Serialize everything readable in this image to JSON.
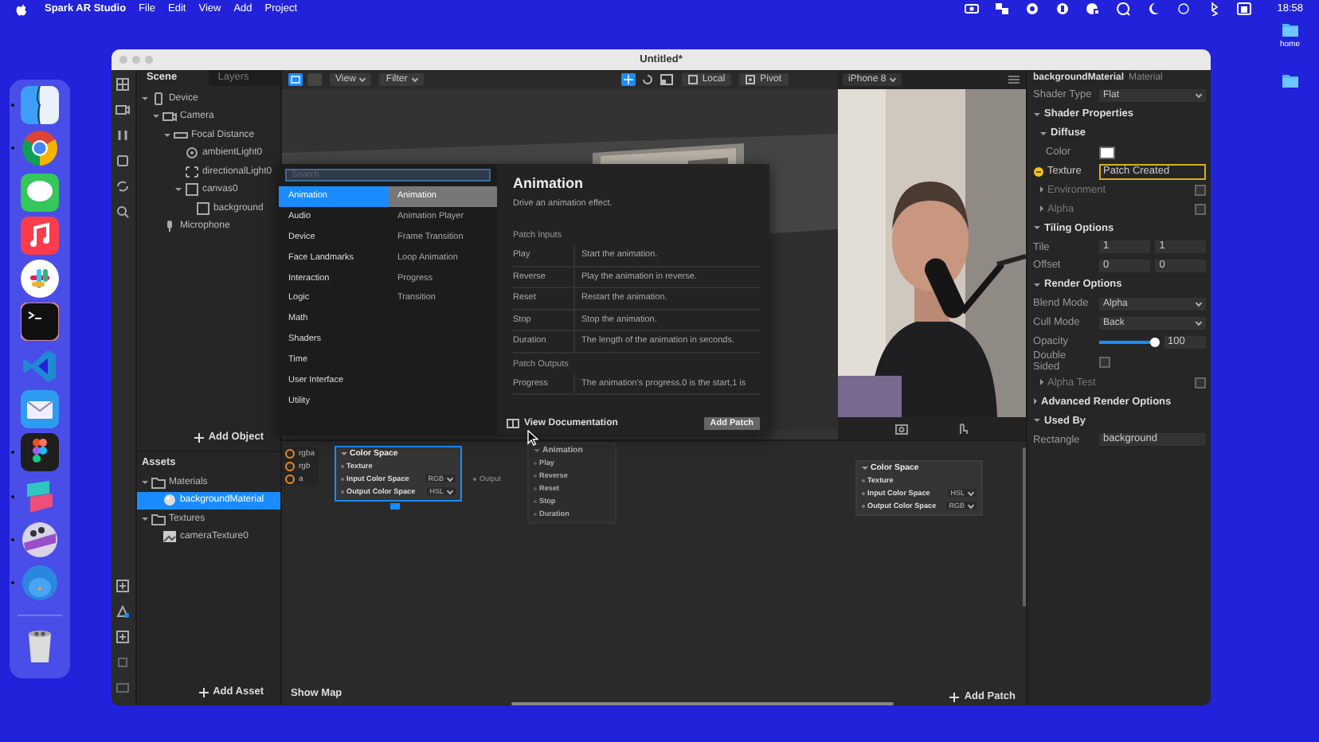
{
  "menubar": {
    "app": "Spark AR Studio",
    "menus": [
      "File",
      "Edit",
      "View",
      "Add",
      "Project"
    ],
    "clock": "18:58"
  },
  "desktop": {
    "folders": [
      {
        "label": "home"
      }
    ]
  },
  "dock": {
    "apps": [
      {
        "running": true
      },
      {
        "running": true
      },
      {
        "running": false
      },
      {
        "running": false
      },
      {
        "running": false
      },
      {
        "running": false
      },
      {
        "running": false
      },
      {
        "running": false
      },
      {
        "running": true
      },
      {
        "running": true
      },
      {
        "running": true
      },
      {
        "running": true
      },
      {
        "running": false
      }
    ]
  },
  "window": {
    "title": "Untitled*"
  },
  "scene": {
    "tabs": [
      {
        "label": "Scene",
        "selected": true
      },
      {
        "label": "Layers",
        "selected": false
      }
    ],
    "tree": [
      {
        "label": "Device",
        "kind": "device",
        "expanded": true,
        "children": [
          {
            "label": "Camera",
            "kind": "camera",
            "expanded": true,
            "children": [
              {
                "label": "Focal Distance",
                "kind": "focal",
                "expanded": true,
                "children": [
                  {
                    "label": "ambientLight0",
                    "kind": "light"
                  },
                  {
                    "label": "directionalLight0",
                    "kind": "directional"
                  },
                  {
                    "label": "canvas0",
                    "kind": "canvas",
                    "expanded": true,
                    "children": [
                      {
                        "label": "background",
                        "kind": "rect"
                      }
                    ]
                  }
                ]
              }
            ]
          },
          {
            "label": "Microphone",
            "kind": "mic"
          }
        ]
      }
    ],
    "add_button": "Add Object"
  },
  "assets": {
    "title": "Assets",
    "tree": [
      {
        "label": "Materials",
        "kind": "folder",
        "expanded": true,
        "selected": false,
        "children": [
          {
            "label": "backgroundMaterial",
            "kind": "material",
            "selected": true
          }
        ]
      },
      {
        "label": "Textures",
        "kind": "folder",
        "expanded": true,
        "selected": false,
        "children": [
          {
            "label": "cameraTexture0",
            "kind": "texture",
            "selected": false
          }
        ]
      }
    ],
    "add_button": "Add Asset"
  },
  "viewport": {
    "view": "View",
    "filter": "Filter",
    "local": "Local",
    "pivot": "Pivot"
  },
  "simulator": {
    "device": "iPhone 8"
  },
  "popup": {
    "search_placeholder": "Search",
    "categories": [
      {
        "label": "Animation",
        "selected": true
      },
      {
        "label": "Audio",
        "selected": false
      },
      {
        "label": "Device",
        "selected": false
      },
      {
        "label": "Face Landmarks",
        "selected": false
      },
      {
        "label": "Interaction",
        "selected": false
      },
      {
        "label": "Logic",
        "selected": false
      },
      {
        "label": "Math",
        "selected": false
      },
      {
        "label": "Shaders",
        "selected": false
      },
      {
        "label": "Time",
        "selected": false
      },
      {
        "label": "User Interface",
        "selected": false
      },
      {
        "label": "Utility",
        "selected": false
      }
    ],
    "patches": [
      {
        "label": "Animation",
        "selected": true
      },
      {
        "label": "Animation Player",
        "selected": false
      },
      {
        "label": "Frame Transition",
        "selected": false
      },
      {
        "label": "Loop Animation",
        "selected": false
      },
      {
        "label": "Progress",
        "selected": false
      },
      {
        "label": "Transition",
        "selected": false
      }
    ],
    "detail": {
      "title": "Animation",
      "description": "Drive an animation effect.",
      "inputs_heading": "Patch Inputs",
      "inputs": [
        {
          "name": "Play",
          "text": "Start the animation."
        },
        {
          "name": "Reverse",
          "text": "Play the animation in reverse."
        },
        {
          "name": "Reset",
          "text": "Restart the animation."
        },
        {
          "name": "Stop",
          "text": "Stop the animation."
        },
        {
          "name": "Duration",
          "text": "The length of the animation in seconds."
        }
      ],
      "outputs_heading": "Patch Outputs",
      "outputs": [
        {
          "name": "Progress",
          "text": "The animation's progress.0 is the start,1 is"
        }
      ],
      "doc_link": "View Documentation",
      "add_button": "Add Patch"
    }
  },
  "patch_editor": {
    "inputs": [
      "rgba",
      "rgb",
      "a"
    ],
    "nodes": [
      {
        "title": "Color Space",
        "selected": true,
        "faded": false,
        "output": "Output",
        "rows": [
          {
            "label": "Texture"
          },
          {
            "label": "Input Color Space",
            "value": "RGB"
          },
          {
            "label": "Output Color Space",
            "value": "HSL"
          }
        ]
      },
      {
        "title": "Animation",
        "selected": false,
        "faded": true,
        "rows": [
          {
            "label": "Play"
          },
          {
            "label": "Reverse"
          },
          {
            "label": "Reset"
          },
          {
            "label": "Stop"
          },
          {
            "label": "Duration"
          }
        ]
      },
      {
        "title": "Color Space",
        "selected": false,
        "faded": false,
        "rows": [
          {
            "label": "Texture"
          },
          {
            "label": "Input Color Space",
            "value": "HSL"
          },
          {
            "label": "Output Color Space",
            "value": "RGB"
          }
        ]
      }
    ],
    "show_map": "Show Map",
    "add_patch": "Add Patch"
  },
  "inspector": {
    "title": "backgroundMaterial",
    "subtitle": "Material",
    "rows": [
      {
        "kind": "dropdown",
        "label": "Shader Type",
        "value": "Flat"
      },
      {
        "kind": "section",
        "label": "Shader Properties",
        "expanded": true
      },
      {
        "kind": "subsection",
        "label": "Diffuse",
        "expanded": true
      },
      {
        "kind": "color",
        "label": "Color",
        "color": "#ffffff"
      },
      {
        "kind": "texture",
        "label": "Texture",
        "value": "Patch Created"
      },
      {
        "kind": "option",
        "label": "Environment",
        "checked": false
      },
      {
        "kind": "option",
        "label": "Alpha",
        "checked": false
      },
      {
        "kind": "section",
        "label": "Tiling Options",
        "expanded": true
      },
      {
        "kind": "pair",
        "label": "Tile",
        "values": [
          "1",
          "1"
        ]
      },
      {
        "kind": "pair",
        "label": "Offset",
        "values": [
          "0",
          "0"
        ]
      },
      {
        "kind": "section",
        "label": "Render Options",
        "expanded": true
      },
      {
        "kind": "dropdown",
        "label": "Blend Mode",
        "value": "Alpha"
      },
      {
        "kind": "dropdown",
        "label": "Cull Mode",
        "value": "Back"
      },
      {
        "kind": "slider",
        "label": "Opacity",
        "level": 1,
        "value": "100"
      },
      {
        "kind": "checkbox",
        "label": "Double Sided",
        "checked": false
      },
      {
        "kind": "option",
        "label": "Alpha Test",
        "checked": false
      },
      {
        "kind": "section",
        "label": "Advanced Render Options",
        "expanded": false
      },
      {
        "kind": "section",
        "label": "Used By",
        "expanded": true
      },
      {
        "kind": "link",
        "label": "Rectangle",
        "value": "background"
      }
    ]
  }
}
